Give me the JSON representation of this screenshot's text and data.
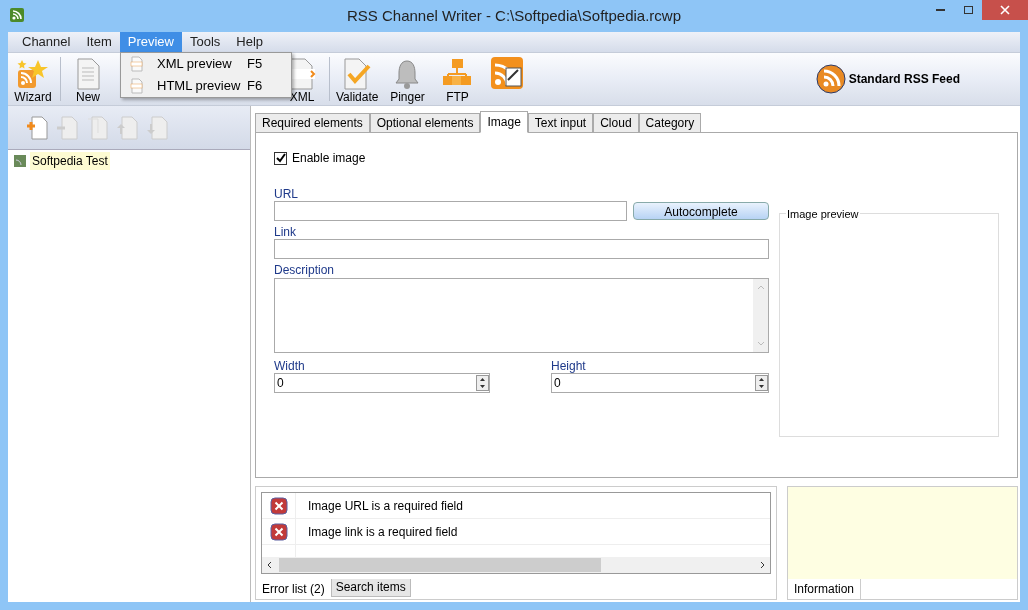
{
  "window": {
    "title": "RSS Channel Writer - C:\\Softpedia\\Softpedia.rcwp"
  },
  "menu": [
    {
      "label": "Channel",
      "selected": false
    },
    {
      "label": "Item",
      "selected": false
    },
    {
      "label": "Preview",
      "selected": true
    },
    {
      "label": "Tools",
      "selected": false
    },
    {
      "label": "Help",
      "selected": false
    }
  ],
  "dropdown": [
    {
      "label": "XML preview",
      "shortcut": "F5"
    },
    {
      "label": "HTML preview",
      "shortcut": "F6"
    }
  ],
  "toolbar": [
    {
      "kind": "wizard",
      "label": "Wizard"
    },
    {
      "kind": "new",
      "label": "New"
    },
    {
      "kind": "xml",
      "label": "XML"
    },
    {
      "kind": "validate",
      "label": "Validate"
    },
    {
      "kind": "pinger",
      "label": "Pinger"
    },
    {
      "kind": "ftp",
      "label": "FTP"
    },
    {
      "kind": "auto"
    }
  ],
  "feed_type": "Standard RSS Feed",
  "tree": [
    {
      "label": "Softpedia Test",
      "selected": true
    }
  ],
  "tabs": [
    {
      "label": "Required elements",
      "selected": false
    },
    {
      "label": "Optional elements",
      "selected": false
    },
    {
      "label": "Image",
      "selected": true
    },
    {
      "label": "Text input",
      "selected": false
    },
    {
      "label": "Cloud",
      "selected": false
    },
    {
      "label": "Category",
      "selected": false
    }
  ],
  "enable_image": {
    "label": "Enable image",
    "checked": true
  },
  "url_label": "URL",
  "autocomplete": "Autocomplete",
  "link_label": "Link",
  "description_label": "Description",
  "width": {
    "label": "Width",
    "value": "0"
  },
  "height": {
    "label": "Height",
    "value": "0"
  },
  "image_preview": "Image preview",
  "errors": [
    "Image URL is a required field",
    "Image link is a required field"
  ],
  "bottom_tabs": [
    {
      "label": "Error list (2)",
      "selected": true
    },
    {
      "label": "Search items",
      "selected": false
    }
  ],
  "info_tab": "Information"
}
